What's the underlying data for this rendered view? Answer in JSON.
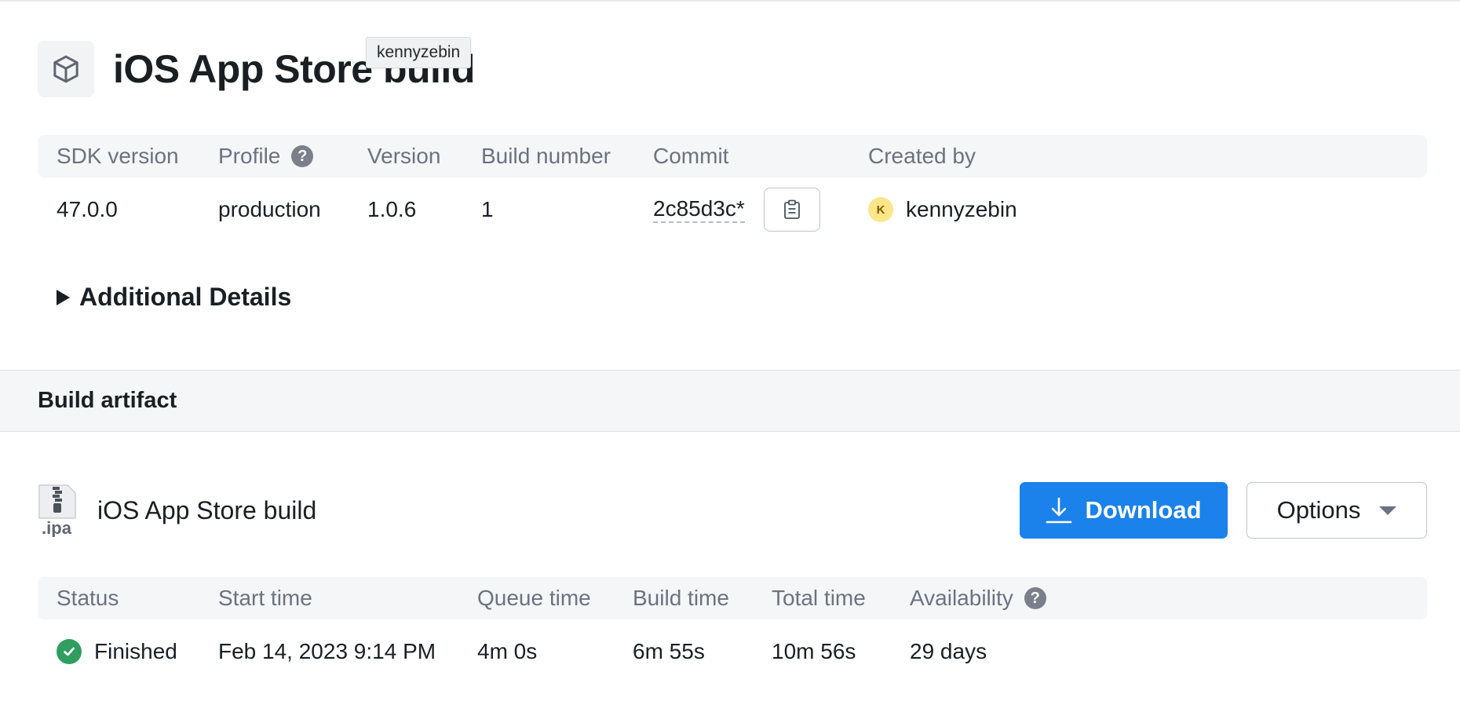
{
  "header": {
    "title": "iOS App Store build",
    "icon": "box-icon",
    "tooltip": "kennyzebin"
  },
  "details_table": {
    "headers": {
      "sdk_version": "SDK version",
      "profile": "Profile",
      "version": "Version",
      "build_number": "Build number",
      "commit": "Commit",
      "created_by": "Created by"
    },
    "help_glyph": "?",
    "values": {
      "sdk_version": "47.0.0",
      "profile": "production",
      "version": "1.0.6",
      "build_number": "1",
      "commit": "2c85d3c*",
      "avatar_initial": "K",
      "created_by": "kennyzebin"
    }
  },
  "additional_details": {
    "label": "Additional Details"
  },
  "artifact_section": {
    "title": "Build artifact",
    "file_icon": "ipa-file-icon",
    "file_ext": ".ipa",
    "name": "iOS App Store build",
    "download_label": "Download",
    "options_label": "Options"
  },
  "status_table": {
    "headers": {
      "status": "Status",
      "start_time": "Start time",
      "queue_time": "Queue time",
      "build_time": "Build time",
      "total_time": "Total time",
      "availability": "Availability"
    },
    "help_glyph": "?",
    "values": {
      "status": "Finished",
      "start_time": "Feb 14, 2023 9:14 PM",
      "queue_time": "4m 0s",
      "build_time": "6m 55s",
      "total_time": "10m 56s",
      "availability": "29 days"
    }
  },
  "colors": {
    "primary": "#1a82ea",
    "success": "#2f9e5f",
    "avatar_bg": "#fde68a",
    "header_bg": "#f5f6f7"
  }
}
